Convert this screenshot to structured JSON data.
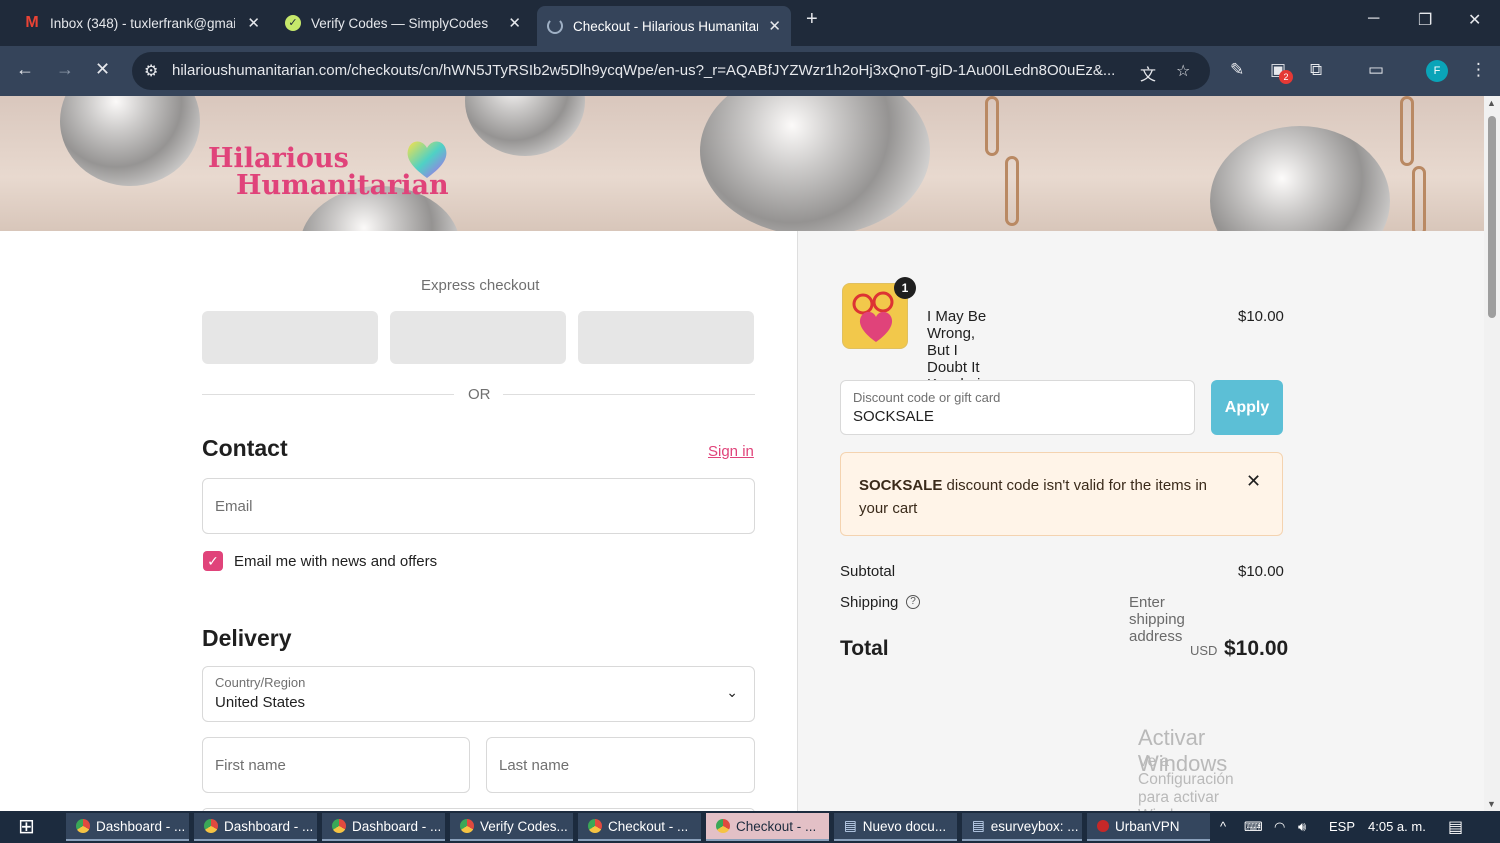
{
  "browser": {
    "tabs": [
      {
        "title": "Inbox (348) - tuxlerfrank@gmail",
        "active": false,
        "icon": "gmail-icon"
      },
      {
        "title": "Verify Codes — SimplyCodes",
        "active": false,
        "icon": "simplycodes-icon"
      },
      {
        "title": "Checkout - Hilarious Humanitarian",
        "active": true,
        "icon": "loading-icon"
      }
    ],
    "new_tab": "+",
    "url": "hilarioushumanitarian.com/checkouts/cn/hWN5JTyRSIb2w5Dlh9ycqWpe/en-us?_r=AQABfJYZWzr1h2oHj3xQnoT-giD-1Au00ILedn8O0uEz&...",
    "profile_initial": "F",
    "extension_badge": "2"
  },
  "store": {
    "logo_line1": "Hilarious",
    "logo_line2": "Humanitarian"
  },
  "checkout": {
    "express_label": "Express checkout",
    "or_label": "OR",
    "contact_heading": "Contact",
    "sign_in": "Sign in",
    "email_placeholder": "Email",
    "newsletter_label": "Email me with news and offers",
    "newsletter_checked": true,
    "delivery_heading": "Delivery",
    "country_label": "Country/Region",
    "country_value": "United States",
    "first_name_placeholder": "First name",
    "last_name_placeholder": "Last name"
  },
  "summary": {
    "item_qty": "1",
    "item_name": "I May Be Wrong, But I Doubt It Keychain",
    "item_price": "$10.00",
    "discount_label": "Discount code or gift card",
    "discount_value": "SOCKSALE",
    "apply_label": "Apply",
    "alert_code": "SOCKSALE",
    "alert_text": " discount code isn't valid for the items in your cart",
    "subtotal_label": "Subtotal",
    "subtotal_value": "$10.00",
    "shipping_label": "Shipping",
    "shipping_value": "Enter shipping address",
    "total_label": "Total",
    "currency": "USD",
    "total_value": "$10.00"
  },
  "watermark": {
    "line1": "Activar Windows",
    "line2": "Ve a Configuración para activar Windows."
  },
  "taskbar": {
    "items": [
      {
        "label": "Dashboard - ...",
        "active": false
      },
      {
        "label": "Dashboard - ...",
        "active": false
      },
      {
        "label": "Dashboard - ...",
        "active": false
      },
      {
        "label": "Verify Codes...",
        "active": false
      },
      {
        "label": "Checkout - ...",
        "active": false
      },
      {
        "label": "Checkout - ...",
        "active": true
      },
      {
        "label": "Nuevo docu...",
        "active": false
      },
      {
        "label": "esurveybox: ...",
        "active": false
      },
      {
        "label": "UrbanVPN",
        "active": false
      }
    ],
    "language": "ESP",
    "time": "4:05 a. m."
  },
  "colors": {
    "brand_pink": "#e0437a",
    "apply_blue": "#5cbfd6",
    "chrome_dark": "#1f2a3a"
  }
}
